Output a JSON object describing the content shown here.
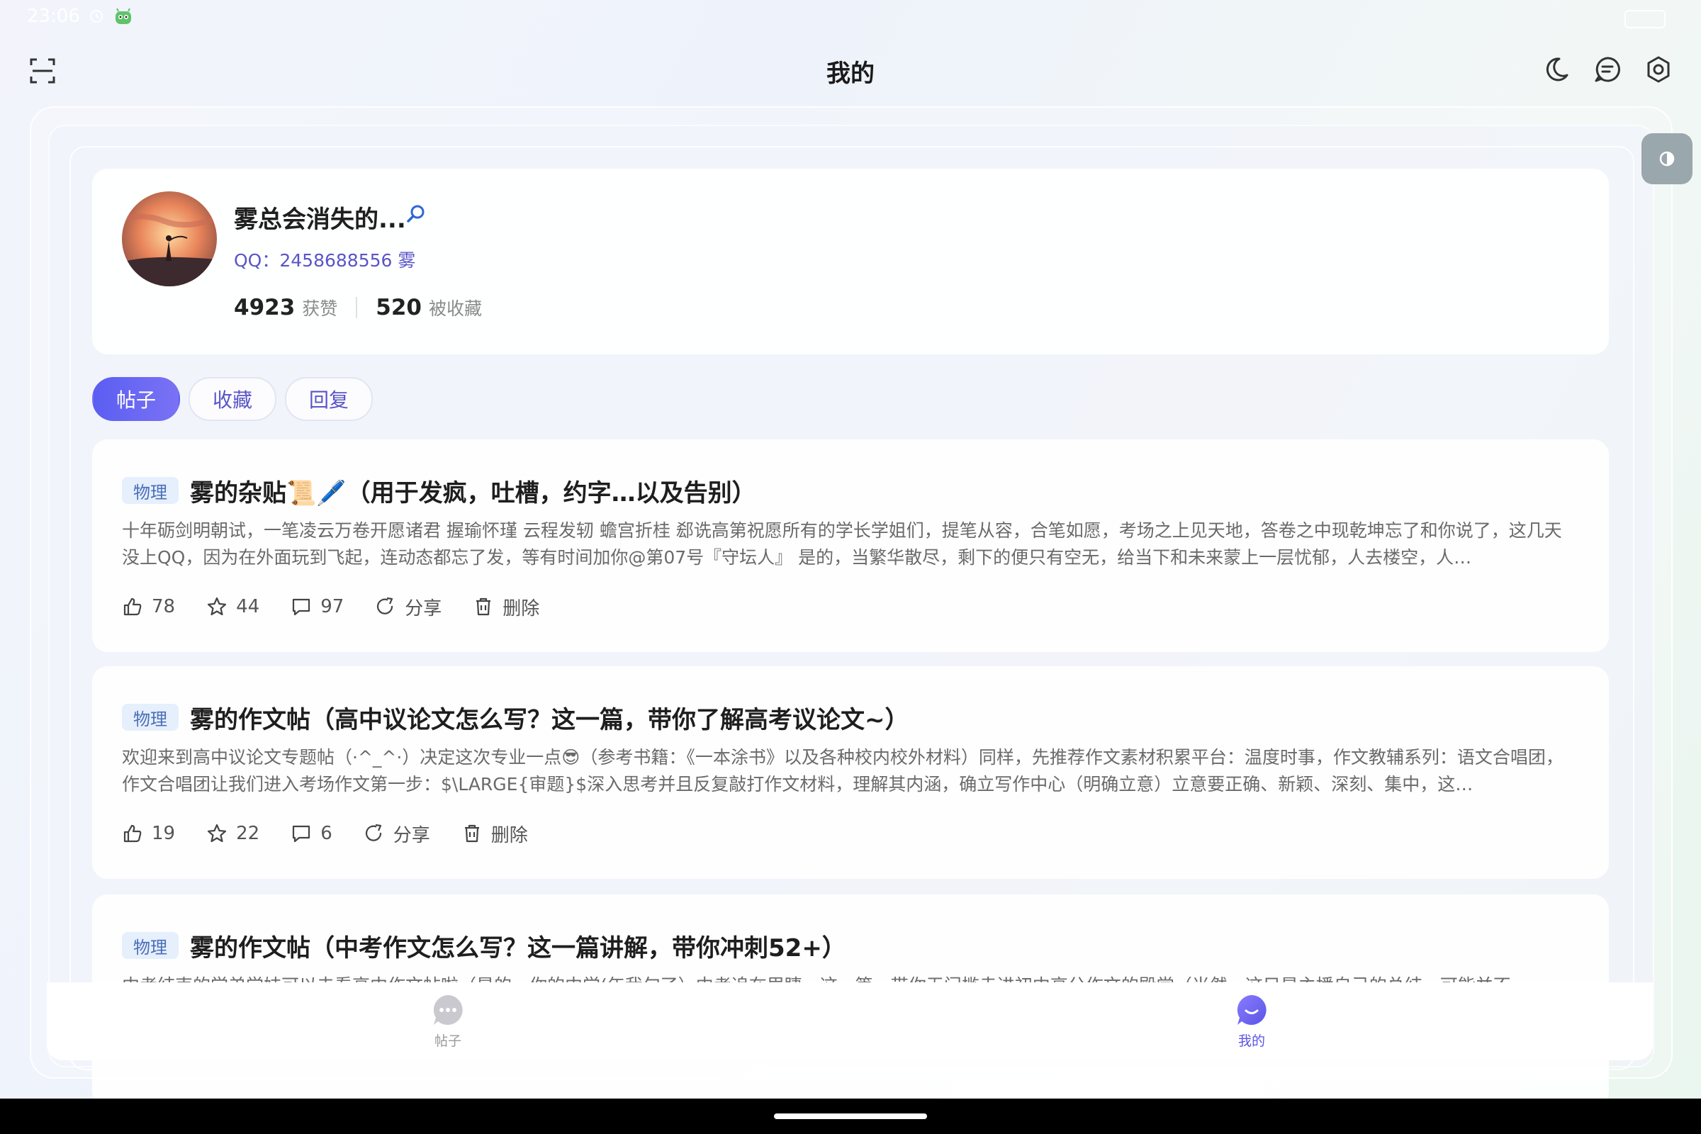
{
  "status_bar": {
    "time": "23:06"
  },
  "header": {
    "title": "我的"
  },
  "profile": {
    "username": "雾总会消失的...",
    "qq_label": "QQ：2458688556 雾",
    "likes_count": "4923",
    "likes_label": "获赞",
    "favorites_count": "520",
    "favorites_label": "被收藏"
  },
  "tabs": [
    {
      "label": "帖子",
      "active": true
    },
    {
      "label": "收藏",
      "active": false
    },
    {
      "label": "回复",
      "active": false
    }
  ],
  "posts": [
    {
      "tag": "物理",
      "title": "雾的杂贴📜🖊️（用于发疯，吐槽，约字…以及告别）",
      "excerpt": "十年砺剑明朝试，一笔凌云万卷开愿诸君 握瑜怀瑾 云程发轫 蟾宫折桂 郄诜高第祝愿所有的学长学姐们，提笔从容，合笔如愿，考场之上见天地，答卷之中现乾坤忘了和你说了，这几天没上QQ，因为在外面玩到飞起，连动态都忘了发，等有时间加你@第07号『守坛人』 是的，当繁华散尽，剩下的便只有空无，给当下和未来蒙上一层忧郁，人去楼空，人…",
      "likes": "78",
      "stars": "44",
      "comments": "97",
      "share_label": "分享",
      "delete_label": "删除"
    },
    {
      "tag": "物理",
      "title": "雾的作文帖（高中议论文怎么写？这一篇，带你了解高考议论文~）",
      "excerpt": "欢迎来到高中议论文专题帖（·^_^·）决定这次专业一点😎（参考书籍：《一本涂书》以及各种校内校外材料）同样，先推荐作文素材积累平台：温度时事，作文教辅系列：语文合唱团，作文合唱团让我们进入考场作文第一步：$\\LARGE{审题}$深入思考并且反复敲打作文材料，理解其内涵，确立写作中心（明确立意）立意要正确、新颖、深刻、集中，这…",
      "likes": "19",
      "stars": "22",
      "comments": "6",
      "share_label": "分享",
      "delete_label": "删除"
    },
    {
      "tag": "物理",
      "title": "雾的作文帖（中考作文怎么写？这一篇讲解，带你冲刺52+）",
      "excerpt": "中考结束的学弟学妹可以去看高中作文帖啦（是的，你的中学(年我句了）中考追在眉睫，这一篇，带你无门槛走进初中高分作文的殿堂（当然，这只是主播自己的总结，可能并不",
      "likes": "",
      "stars": "",
      "comments": "",
      "share_label": "分享",
      "delete_label": "删除"
    }
  ],
  "bottom_nav": [
    {
      "label": "帖子",
      "active": false
    },
    {
      "label": "我的",
      "active": true
    }
  ],
  "colors": {
    "accent": "#5b5ef2",
    "tag_bg": "#e6effc",
    "tag_text": "#4a6fb8"
  }
}
